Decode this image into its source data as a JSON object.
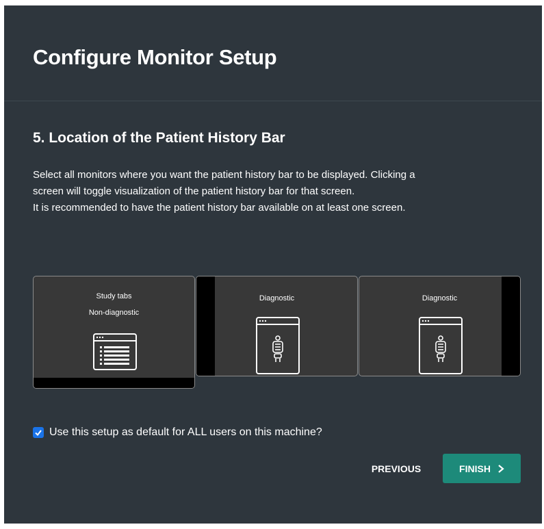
{
  "dialog": {
    "title": "Configure Monitor Setup",
    "step_title": "5. Location of the Patient History Bar",
    "description_lines": [
      "Select all monitors where you want the patient history bar to be displayed. Clicking a",
      "screen will toggle visualization of the patient history bar for that screen.",
      "It is recommended to have the patient history bar available on at least one screen."
    ]
  },
  "monitors": [
    {
      "line1": "Study tabs",
      "line2": "Non-diagnostic",
      "history_bar": "bottom",
      "selected": true,
      "icon": "worklist-window-icon"
    },
    {
      "line1": "Diagnostic",
      "history_bar": "left",
      "selected": false,
      "icon": "xray-window-icon"
    },
    {
      "line1": "Diagnostic",
      "history_bar": "right",
      "selected": false,
      "icon": "xray-window-icon"
    }
  ],
  "default_setup": {
    "checked": true,
    "label": "Use this setup as default for ALL users on this machine?"
  },
  "buttons": {
    "previous": "PREVIOUS",
    "finish": "FINISH",
    "finish_icon": "chevron-right-icon"
  },
  "colors": {
    "background": "#2e363d",
    "accent": "#1d8a7a",
    "checkbox": "#1a73e8",
    "monitor_bg": "#383838",
    "history_bar": "#000000"
  }
}
